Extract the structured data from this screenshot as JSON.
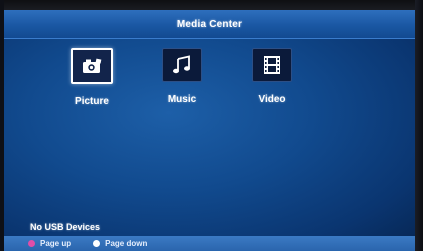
{
  "header": {
    "title": "Media Center"
  },
  "menu": {
    "items": [
      {
        "label": "Picture",
        "icon": "picture-icon",
        "selected": true
      },
      {
        "label": "Music",
        "icon": "music-icon",
        "selected": false
      },
      {
        "label": "Video",
        "icon": "video-icon",
        "selected": false
      }
    ]
  },
  "status": {
    "message": "No USB Devices"
  },
  "footer": {
    "hints": [
      {
        "label": "Page up",
        "color": "#e04ea8"
      },
      {
        "label": "Page down",
        "color": "#ffffff"
      }
    ]
  },
  "colors": {
    "background": "#114a8e",
    "title_bar": "#1a57a3",
    "footer_bar": "#2a65ad",
    "icon_bg": "#0b1a3a"
  }
}
